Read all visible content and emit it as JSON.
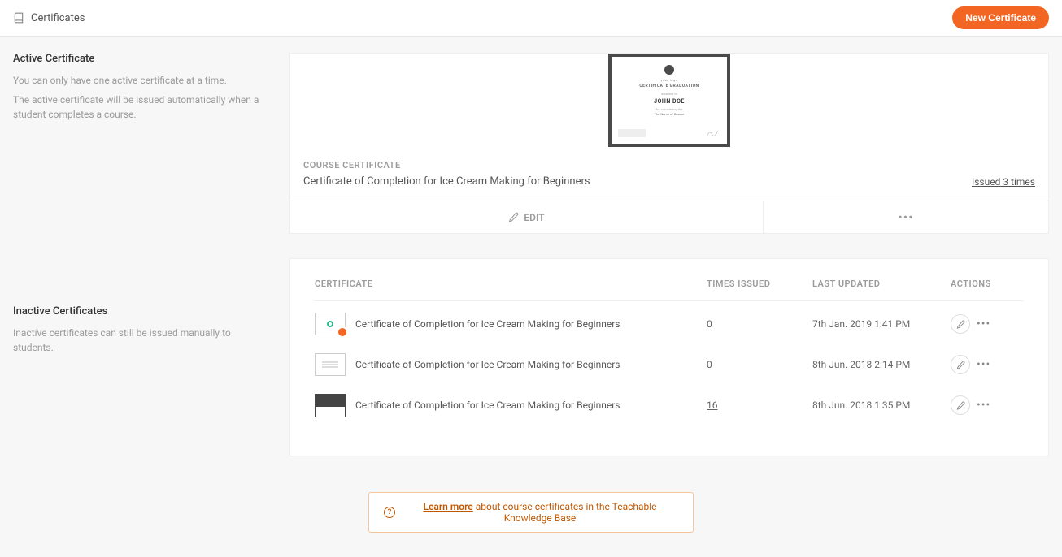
{
  "header": {
    "title": "Certificates",
    "new_button": "New Certificate"
  },
  "active": {
    "heading": "Active Certificate",
    "desc1": "You can only have one active certificate at a time.",
    "desc2": "The active certificate will be issued automatically when a student completes a course.",
    "preview": {
      "line1": "your logo",
      "line2": "CERTIFICATE GRADUATION",
      "line3": "awarded to",
      "name": "JOHN DOE",
      "line4": "for completing the",
      "line5": "The Name of Course"
    },
    "course_label": "COURSE CERTIFICATE",
    "cert_name": "Certificate of Completion for Ice Cream Making for Beginners",
    "issued_text": "Issued 3 times",
    "edit_label": "EDIT"
  },
  "inactive": {
    "heading": "Inactive Certificates",
    "desc": "Inactive certificates can still be issued manually to students.",
    "columns": {
      "certificate": "CERTIFICATE",
      "times_issued": "TIMES ISSUED",
      "last_updated": "LAST UPDATED",
      "actions": "ACTIONS"
    },
    "rows": [
      {
        "name": "Certificate of Completion for Ice Cream Making for Beginners",
        "times": "0",
        "updated": "7th Jan. 2019 1:41 PM",
        "underline": false
      },
      {
        "name": "Certificate of Completion for Ice Cream Making for Beginners",
        "times": "0",
        "updated": "8th Jun. 2018 2:14 PM",
        "underline": false
      },
      {
        "name": "Certificate of Completion for Ice Cream Making for Beginners",
        "times": "16",
        "updated": "8th Jun. 2018 1:35 PM",
        "underline": true
      }
    ]
  },
  "footer": {
    "link": "Learn more",
    "text": " about course certificates in the Teachable Knowledge Base"
  }
}
